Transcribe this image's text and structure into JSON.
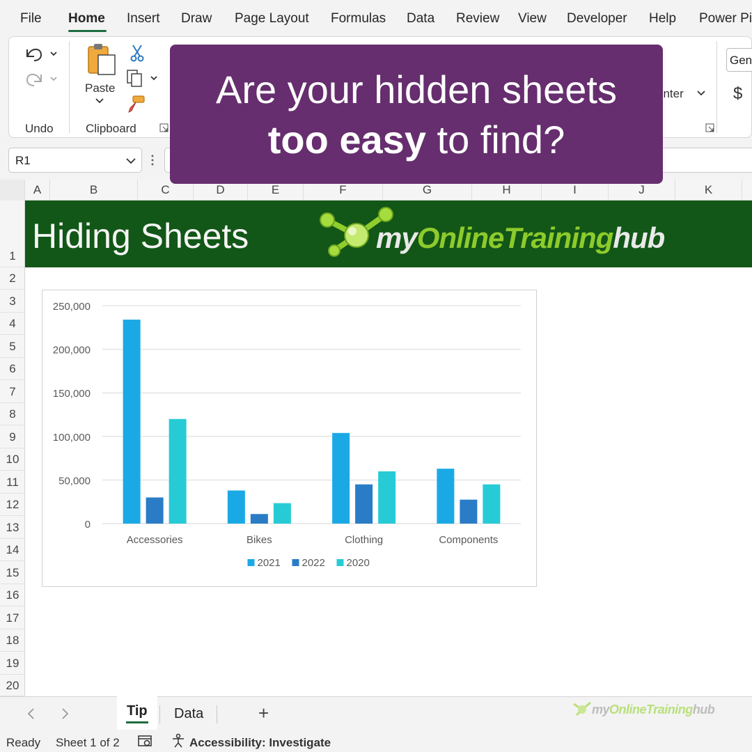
{
  "menu": {
    "items": [
      "File",
      "Home",
      "Insert",
      "Draw",
      "Page Layout",
      "Formulas",
      "Data",
      "Review",
      "View",
      "Developer",
      "Help",
      "Power Pi"
    ],
    "active": "Home"
  },
  "ribbon": {
    "undo_group_label": "Undo",
    "clipboard_group_label": "Clipboard",
    "paste_label": "Paste",
    "merge_center_partial": "enter",
    "number_format_partial": "Gen",
    "currency_symbol": "$"
  },
  "formula_bar": {
    "name_box_value": "R1"
  },
  "grid": {
    "columns": [
      "A",
      "B",
      "C",
      "D",
      "E",
      "F",
      "G",
      "H",
      "I",
      "J",
      "K"
    ],
    "rows": [
      "1",
      "2",
      "3",
      "4",
      "5",
      "6",
      "7",
      "8",
      "9",
      "10",
      "11",
      "12",
      "13",
      "14",
      "15",
      "16",
      "17",
      "18",
      "19",
      "20"
    ]
  },
  "banner": {
    "title": "Hiding Sheets",
    "logo_text_my": "my",
    "logo_text_online": "Online",
    "logo_text_training": "Training",
    "logo_text_hub": "hub",
    "background_color": "#125717"
  },
  "overlay": {
    "line1": "Are your hidden sheets",
    "line2_bold": "too easy",
    "line2_rest": " to find?",
    "background_color": "#662e6e"
  },
  "chart_data": {
    "type": "bar",
    "categories": [
      "Accessories",
      "Bikes",
      "Clothing",
      "Components"
    ],
    "series": [
      {
        "name": "2021",
        "color": "#1ba9e6",
        "values": [
          234000,
          38000,
          104000,
          63000
        ]
      },
      {
        "name": "2022",
        "color": "#2a7cc7",
        "values": [
          30000,
          11000,
          45000,
          27500
        ]
      },
      {
        "name": "2020",
        "color": "#27cbd6",
        "values": [
          120000,
          23500,
          60000,
          45000
        ]
      }
    ],
    "y_ticks": [
      "0",
      "50,000",
      "100,000",
      "150,000",
      "200,000",
      "250,000"
    ],
    "ylim": [
      0,
      250000
    ],
    "grid": true,
    "legend": "bottom"
  },
  "sheet_tabs": {
    "tabs": [
      "Tip",
      "Data"
    ],
    "active": "Tip",
    "add_symbol": "+"
  },
  "status_bar": {
    "ready": "Ready",
    "sheet_count": "Sheet 1 of 2",
    "accessibility": "Accessibility: Investigate"
  }
}
